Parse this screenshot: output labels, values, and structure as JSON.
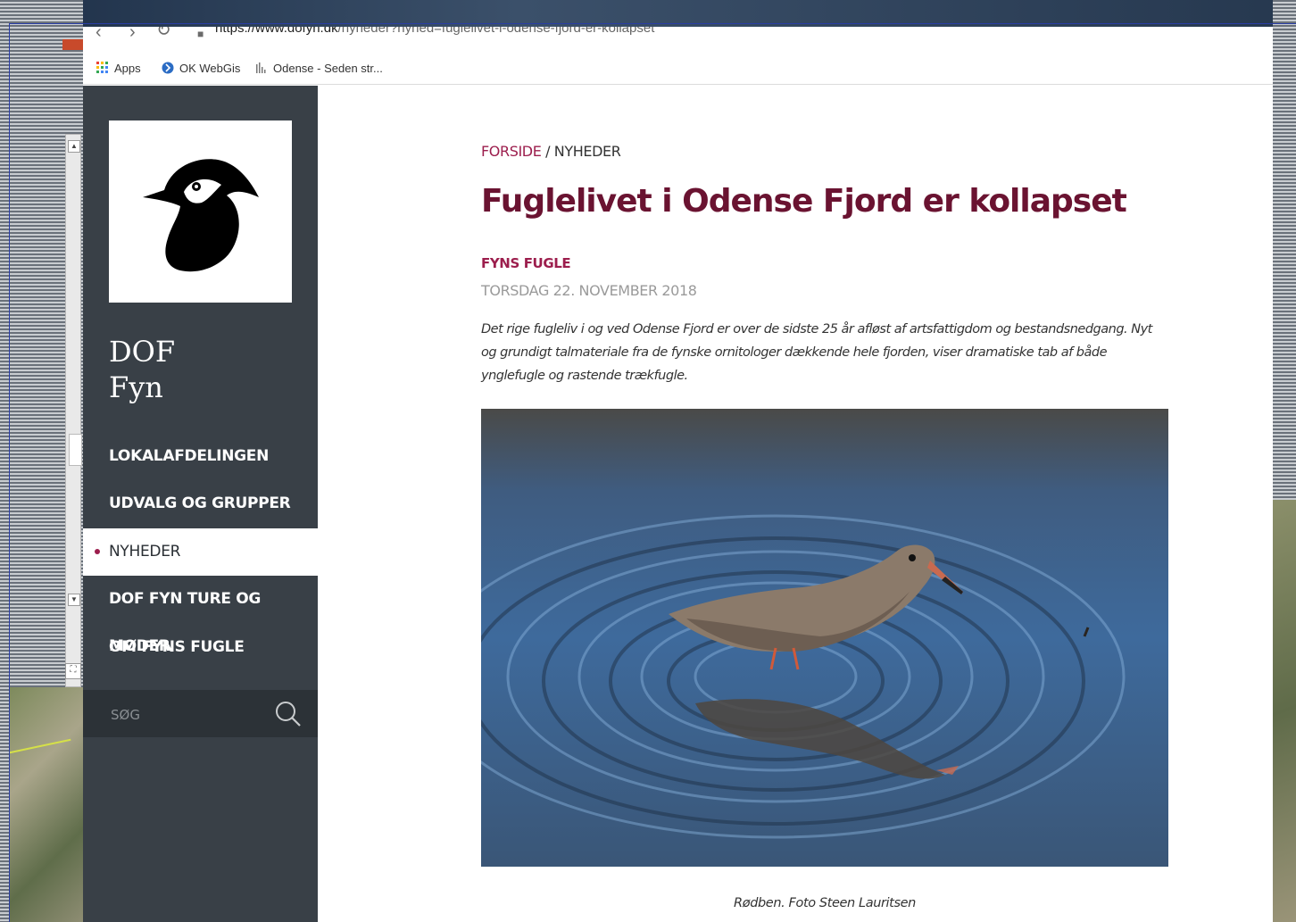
{
  "browser": {
    "url_host": "https://www.dofyn.dk",
    "url_path": "/nyheder?nyhed=fuglelivet-i-odense-fjord-er-kollapset",
    "bookmarks": [
      {
        "label": "Apps",
        "icon": "apps-grid-icon"
      },
      {
        "label": "OK WebGis",
        "icon": "globe-icon"
      },
      {
        "label": "Odense - Seden str...",
        "icon": "signal-bars-icon"
      }
    ]
  },
  "sidebar": {
    "site_name_line1": "DOF",
    "site_name_line2": "Fyn",
    "nav": [
      {
        "label": "LOKALAFDELINGEN",
        "active": false
      },
      {
        "label": "UDVALG OG GRUPPER",
        "active": false
      },
      {
        "label": "NYHEDER",
        "active": true
      },
      {
        "label": "DOF FYN TURE OG MØDER",
        "active": false
      },
      {
        "label": "OM FYNS FUGLE",
        "active": false
      }
    ],
    "search_placeholder": "SØG"
  },
  "article": {
    "breadcrumb_home": "FORSIDE",
    "breadcrumb_separator": " / ",
    "breadcrumb_current": "NYHEDER",
    "title": "Fuglelivet i Odense Fjord er kollapset",
    "category": "FYNS FUGLE",
    "date": "TORSDAG 22. NOVEMBER 2018",
    "lead": "Det rige fugleliv i og ved Odense Fjord er over de sidste 25 år afløst af artsfattigdom og bestandsnedgang. Nyt og grundigt talmateriale fra de fynske ornitologer dækkende hele fjorden, viser dramatiske tab af både ynglefugle og rastende trækfugle.",
    "caption": "Rødben. Foto Steen Lauritsen"
  },
  "colors": {
    "accent": "#9c1e4d",
    "title": "#6a1331",
    "sidebar_bg": "#394047"
  }
}
